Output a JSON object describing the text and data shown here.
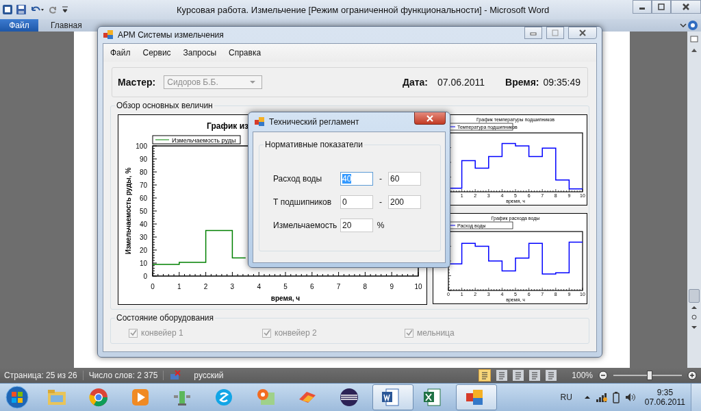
{
  "word": {
    "title": "Курсовая работа. Измельчение [Режим ограниченной функциональности]  -  Microsoft Word",
    "file_tab": "Файл",
    "tabs": [
      "Главная"
    ]
  },
  "app": {
    "title": "АРМ Системы измельчения",
    "menu": [
      "Файл",
      "Сервис",
      "Запросы",
      "Справка"
    ],
    "master": {
      "label": "Мастер:",
      "value": "Сидоров Б.Б.",
      "disabled": true
    },
    "date": {
      "label": "Дата:",
      "value": "07.06.2011"
    },
    "time": {
      "label": "Время:",
      "value": "09:35:49"
    },
    "overview": {
      "title": "Обзор основных величин",
      "main_chart": {
        "chart_data": {
          "type": "line",
          "title": "График из",
          "xlabel": "время, ч",
          "ylabel": "Измельчаемость руды, %",
          "x": [
            0,
            1,
            1,
            2,
            2,
            3,
            3,
            3.5
          ],
          "series": [
            {
              "name": "Измельчаемость руды",
              "color": "#008000",
              "values": [
                9,
                9,
                10.5,
                10.5,
                35,
                35,
                14,
                14
              ]
            }
          ],
          "xlim": [
            0,
            10
          ],
          "ylim": [
            0,
            100
          ],
          "xticks": [
            0,
            1,
            2,
            3,
            4,
            5,
            6,
            7,
            8,
            9,
            10
          ],
          "yticks": [
            0,
            10,
            20,
            30,
            40,
            50,
            60,
            70,
            80,
            90,
            100
          ]
        }
      },
      "mini_charts": [
        {
          "title": "График температуры подшипников",
          "legend": "Температура подшипников",
          "xlabel": "время, ч",
          "xticks": [
            "1",
            "2",
            "3",
            "4",
            "5",
            "6",
            "7",
            "8",
            "9",
            "10"
          ]
        },
        {
          "title": "График расхода воды",
          "legend": "Расход воды",
          "xlabel": "время, ч",
          "xticks": [
            "0",
            "1",
            "2",
            "3",
            "4",
            "5",
            "6",
            "7",
            "8",
            "9",
            "10"
          ]
        }
      ]
    },
    "equipment": {
      "title": "Состояние оборудования",
      "items": [
        {
          "label": "конвейер 1",
          "checked": true,
          "disabled": true
        },
        {
          "label": "конвейер 2",
          "checked": true,
          "disabled": true
        },
        {
          "label": "мельница",
          "checked": true,
          "disabled": true
        }
      ]
    }
  },
  "dialog": {
    "title": "Технический регламент",
    "group": "Нормативные показатели",
    "rows": [
      {
        "kind": "range",
        "label": "Расход воды",
        "from": "40",
        "separator": "-",
        "to": "60",
        "focused": true
      },
      {
        "kind": "range",
        "label": "Т подшипников",
        "from": "0",
        "separator": "-",
        "to": "200",
        "focused": false
      },
      {
        "kind": "single",
        "label": "Измельчаемость",
        "value": "20",
        "unit": "%",
        "focused": false
      }
    ]
  },
  "status_bar": {
    "page": "Страница: 25 из 26",
    "words": "Число слов: 2 375",
    "language": "русский",
    "views": [
      {
        "selected": true
      },
      {
        "selected": false
      },
      {
        "selected": false
      },
      {
        "selected": false
      },
      {
        "selected": false
      }
    ],
    "zoom": "100%",
    "zoom_slider": {
      "level": 0.52
    }
  },
  "taskbar": {
    "items": [
      {
        "kind": "folder",
        "selected": false
      },
      {
        "kind": "browser",
        "selected": false
      },
      {
        "kind": "media",
        "selected": false
      },
      {
        "kind": "gadget",
        "selected": false
      },
      {
        "kind": "chat",
        "selected": false
      },
      {
        "kind": "map",
        "selected": false
      },
      {
        "kind": "ribbon",
        "selected": false
      },
      {
        "kind": "sphere",
        "selected": false
      },
      {
        "kind": "document",
        "selected": true
      },
      {
        "kind": "sheet",
        "selected": false
      },
      {
        "kind": "app",
        "selected": true
      }
    ],
    "language": "RU",
    "time": "9:35",
    "date": "07.06.2011"
  }
}
